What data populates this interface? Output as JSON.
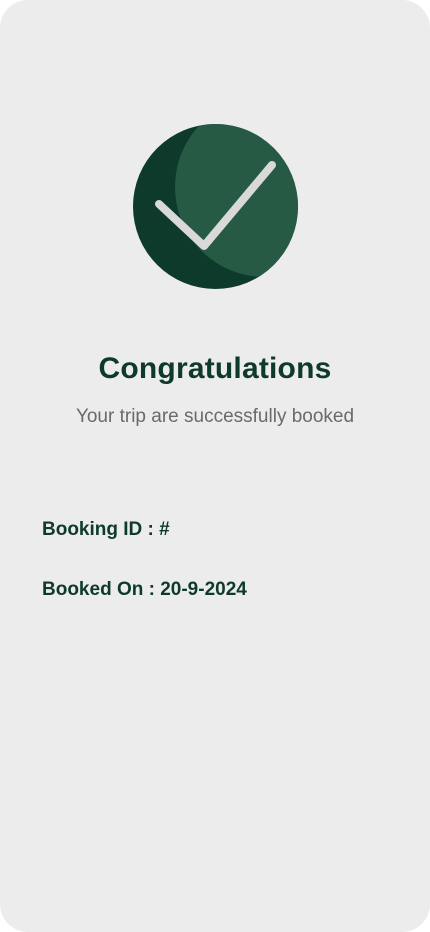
{
  "theme": {
    "background": "#ececec",
    "accent_dark": "#0e3a2b",
    "accent_light": "#275a45",
    "check_color": "#d9d9d9",
    "muted_text": "#6a6a6a"
  },
  "success": {
    "icon": "check-circle-icon",
    "title": "Congratulations",
    "subtitle": "Your trip are successfully booked"
  },
  "booking": {
    "id_label": "Booking ID : #",
    "booked_on_label": "Booked On : 20-9-2024"
  }
}
